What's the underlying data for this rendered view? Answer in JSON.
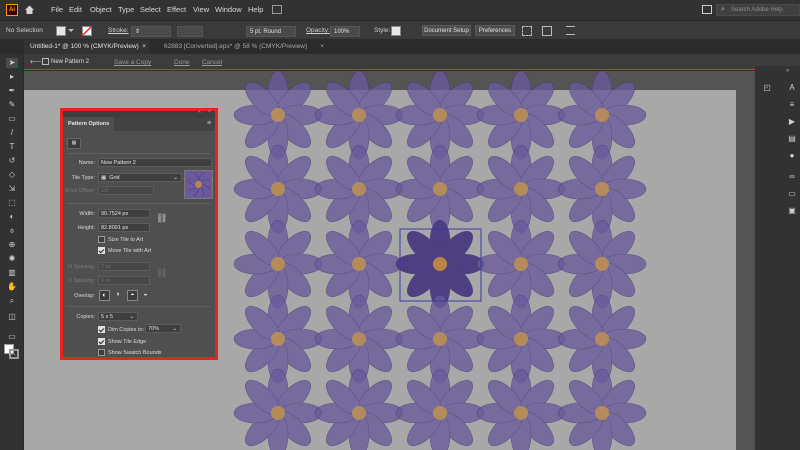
{
  "menubar": {
    "app_logo": "Ai",
    "items": [
      "File",
      "Edit",
      "Object",
      "Type",
      "Select",
      "Effect",
      "View",
      "Window",
      "Help"
    ],
    "search_placeholder": "Search Adobe Help"
  },
  "control_bar": {
    "selection": "No Selection",
    "stroke_label": "Stroke:",
    "brush_value": "5 pt. Round",
    "opacity_label": "Opacity:",
    "opacity_value": "100%",
    "style_label": "Style:",
    "document_setup": "Document Setup",
    "preferences": "Preferences"
  },
  "doc_tabs": [
    {
      "label": "Untitled-1* @ 100 % (CMYK/Preview)",
      "close": "×"
    },
    {
      "label": "62883 [Converted].eps* @ 58 % (CMYK/Preview)",
      "close": "×"
    }
  ],
  "pattern_bar": {
    "pattern_name": "New Pattern 2",
    "save_copy": "Save a Copy",
    "done": "Done",
    "cancel": "Cancel"
  },
  "pattern_options": {
    "title": "Pattern Options",
    "name_label": "Name:",
    "name_value": "New Pattern 2",
    "tile_type_label": "Tile Type:",
    "tile_type_value": "Grid",
    "brick_offset_label": "Brick Offset:",
    "brick_offset_value": "1/2",
    "width_label": "Width:",
    "width_value": "90.7524 px",
    "height_label": "Height:",
    "height_value": "82.8091 px",
    "size_tile_to_art": "Size Tile to Art",
    "move_tile_with_art": "Move Tile with Art",
    "h_spacing_label": "H Spacing:",
    "h_spacing_value": "0 px",
    "v_spacing_label": "V Spacing:",
    "v_spacing_value": "0 px",
    "overlap_label": "Overlap:",
    "copies_label": "Copies:",
    "copies_value": "5 x 5",
    "dim_copies_to": "Dim Copies to:",
    "dim_copies_value": "70%",
    "show_tile_edge": "Show Tile Edge",
    "show_swatch_bounds": "Show Swatch Bounds"
  },
  "colors": {
    "petal": "#6a5a9c",
    "petal_center": "#4e3f82",
    "flower_center": "#b98447",
    "accent_red": "#e52420",
    "artboard": "#a8a8a8"
  }
}
